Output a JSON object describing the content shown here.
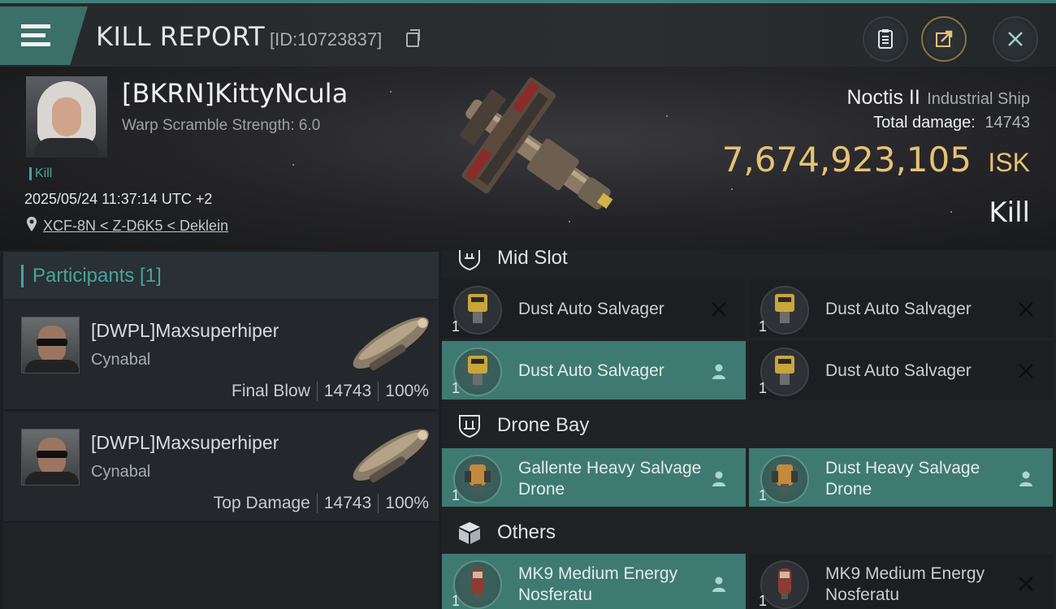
{
  "header": {
    "title": "KILL REPORT",
    "id_text": "[ID:10723837]"
  },
  "victim": {
    "name": "[BKRN]KittyNcula",
    "warp_scramble": "Warp Scramble Strength: 6.0",
    "tag": "Kill",
    "time": "2025/05/24 11:37:14 UTC +2",
    "location": "XCF-8N < Z-D6K5 < Deklein"
  },
  "ship": {
    "name": "Noctis II",
    "class": "Industrial Ship",
    "total_damage_label": "Total damage:",
    "total_damage": "14743",
    "isk_value": "7,674,923,105",
    "isk_unit": "ISK",
    "result": "Kill"
  },
  "participants": {
    "title": "Participants [1]",
    "rows": [
      {
        "name": "[DWPL]Maxsuperhiper",
        "ship": "Cynabal",
        "role": "Final Blow",
        "damage": "14743",
        "percent": "100%"
      },
      {
        "name": "[DWPL]Maxsuperhiper",
        "ship": "Cynabal",
        "role": "Top Damage",
        "damage": "14743",
        "percent": "100%"
      }
    ]
  },
  "fitting": {
    "sections": [
      {
        "title": "Mid Slot",
        "icon": "mid-slot-icon"
      },
      {
        "title": "Drone Bay",
        "icon": "drone-bay-icon"
      },
      {
        "title": "Others",
        "icon": "cargo-box-icon"
      }
    ],
    "mid_slot": [
      {
        "qty": "1",
        "name": "Dust Auto Salvager",
        "status": "destroyed"
      },
      {
        "qty": "1",
        "name": "Dust Auto Salvager",
        "status": "destroyed"
      },
      {
        "qty": "1",
        "name": "Dust Auto Salvager",
        "status": "dropped"
      },
      {
        "qty": "1",
        "name": "Dust Auto Salvager",
        "status": "destroyed"
      }
    ],
    "drone_bay": [
      {
        "qty": "1",
        "name": "Gallente Heavy Salvage Drone",
        "status": "dropped"
      },
      {
        "qty": "1",
        "name": "Dust Heavy Salvage Drone",
        "status": "dropped"
      }
    ],
    "others": [
      {
        "qty": "1",
        "name": "MK9 Medium Energy Nosferatu",
        "status": "dropped"
      },
      {
        "qty": "1",
        "name": "MK9 Medium Energy Nosferatu",
        "status": "destroyed"
      }
    ]
  },
  "colors": {
    "accent_teal": "#3e7a72",
    "isk_gold": "#e6c275",
    "background": "#1b1f23"
  }
}
